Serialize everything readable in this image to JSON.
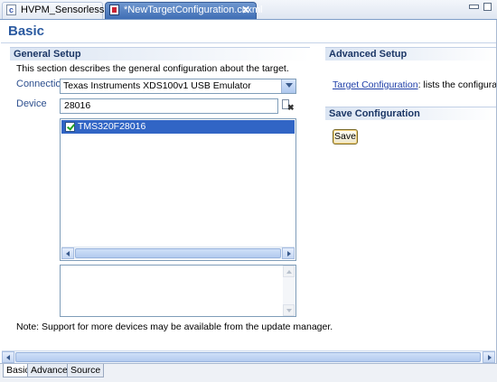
{
  "editor_tabs": [
    {
      "label": "HVPM_Sensorless.c",
      "active": false
    },
    {
      "label": "*NewTargetConfiguration.ccxml",
      "active": true,
      "close": "✕"
    }
  ],
  "page_title": "Basic",
  "general_setup": {
    "heading": "General Setup",
    "description": "This section describes the general configuration about the target.",
    "connection_label": "Connection",
    "connection_value": "Texas Instruments XDS100v1 USB Emulator",
    "device_label": "Device",
    "device_filter": "28016",
    "devices": [
      {
        "label": "TMS320F28016",
        "checked": true
      }
    ],
    "note": "Note: Support for more devices may be available from the update manager."
  },
  "advanced_setup": {
    "heading": "Advanced Setup",
    "link_text": "Target Configuration",
    "link_desc": ": lists the configuration o"
  },
  "save_configuration": {
    "heading": "Save Configuration",
    "button": "Save"
  },
  "page_tabs": [
    {
      "label": "Basic",
      "active": true
    },
    {
      "label": "Advanced",
      "active": false
    },
    {
      "label": "Source",
      "active": false
    }
  ],
  "colors": {
    "title": "#2b5aa0",
    "label": "#2d4f8e",
    "selection": "#3165c5",
    "active_tab": "#4f7cc1"
  },
  "icons": [
    "c-file-icon",
    "ccxml-file-icon",
    "close-icon",
    "chevron-down-icon",
    "filter-clear-icon",
    "checkbox-checked-icon"
  ]
}
